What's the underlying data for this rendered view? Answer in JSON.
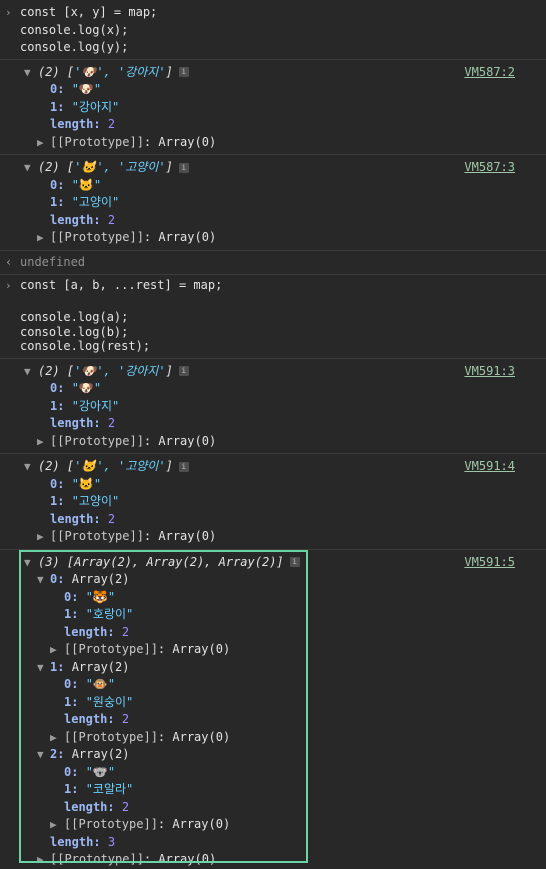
{
  "cmd1": {
    "lines": [
      "const [x, y] = map;",
      "console.log(x);",
      "console.log(y);"
    ]
  },
  "out1": {
    "summary_count": "(2)",
    "summary_a": "'🐶', '강아지'",
    "src": "VM587:2",
    "i0": "\"🐶\"",
    "i1": "\"강아지\"",
    "len": "2",
    "proto": "[[Prototype]]",
    "proto_val": "Array(0)"
  },
  "out2": {
    "summary_count": "(2)",
    "summary_a": "'🐱', '고양이'",
    "src": "VM587:3",
    "i0": "\"🐱\"",
    "i1": "\"고양이\"",
    "len": "2",
    "proto": "[[Prototype]]",
    "proto_val": "Array(0)"
  },
  "undef": "undefined",
  "cmd2": {
    "line1": "const [a, b, ...rest] = map;",
    "lines": [
      "console.log(a);",
      "console.log(b);",
      "console.log(rest);"
    ]
  },
  "out3": {
    "summary_count": "(2)",
    "summary_a": "'🐶', '강아지'",
    "src": "VM591:3",
    "i0": "\"🐶\"",
    "i1": "\"강아지\"",
    "len": "2",
    "proto": "[[Prototype]]",
    "proto_val": "Array(0)"
  },
  "out4": {
    "summary_count": "(2)",
    "summary_a": "'🐱', '고양이'",
    "src": "VM591:4",
    "i0": "\"🐱\"",
    "i1": "\"고양이\"",
    "len": "2",
    "proto": "[[Prototype]]",
    "proto_val": "Array(0)"
  },
  "out5": {
    "summary": "(3) [Array(2), Array(2), Array(2)]",
    "src": "VM591:5",
    "items": [
      {
        "key": "0",
        "label": "Array(2)",
        "v0": "\"🐯\"",
        "v1": "\"호랑이\"",
        "len": "2"
      },
      {
        "key": "1",
        "label": "Array(2)",
        "v0": "\"🐵\"",
        "v1": "\"원숭이\"",
        "len": "2"
      },
      {
        "key": "2",
        "label": "Array(2)",
        "v0": "\"🐨\"",
        "v1": "\"코알라\"",
        "len": "2"
      }
    ],
    "len": "3",
    "proto": "[[Prototype]]",
    "proto_val": "Array(0)"
  },
  "labels": {
    "k0": "0",
    "k1": "1",
    "length": "length",
    "colon": ":"
  },
  "colors": {
    "background": "#282828",
    "highlight_border": "#6ad3a4",
    "link": "#9fc7a7",
    "string": "#6cd1ff",
    "number": "#9f8cff"
  }
}
